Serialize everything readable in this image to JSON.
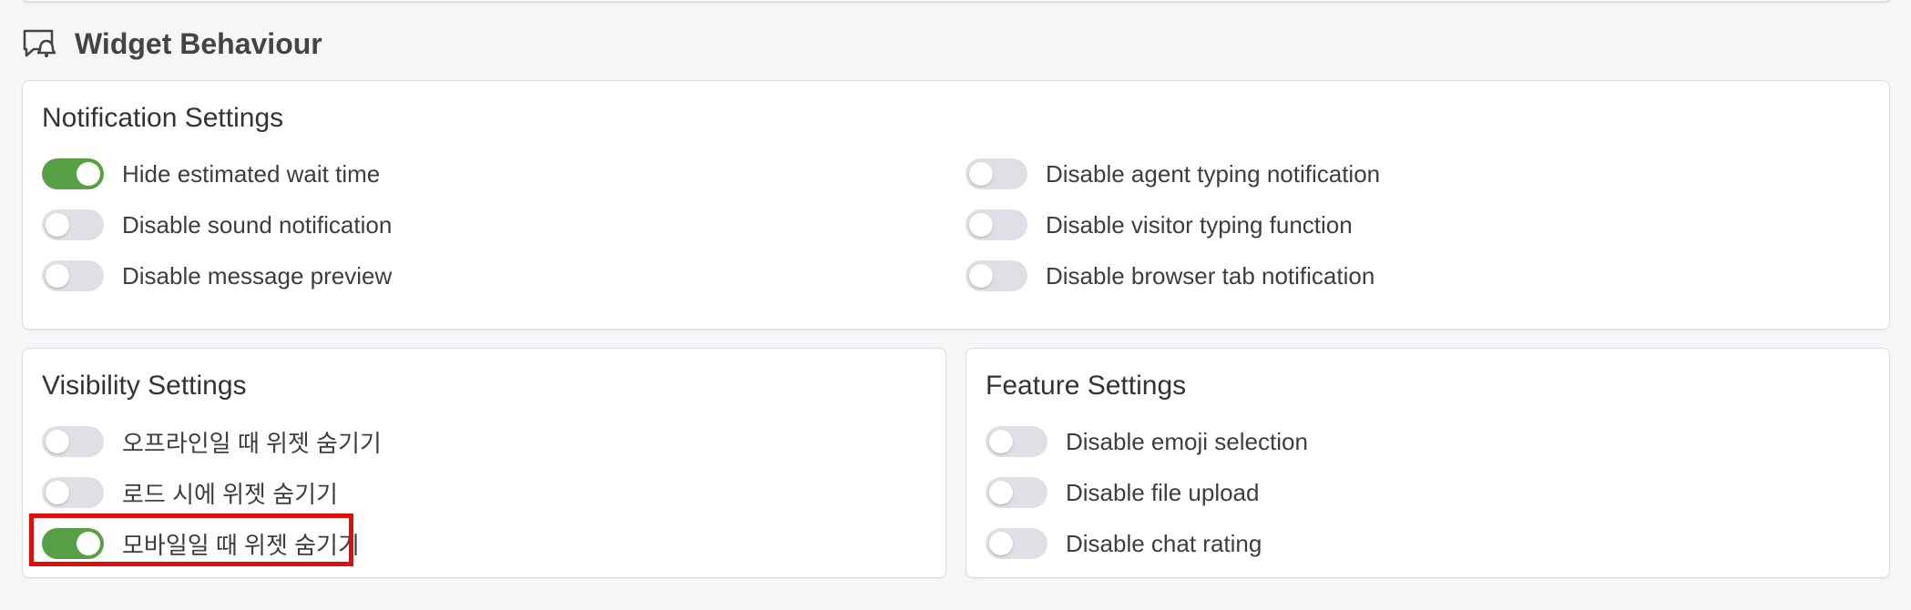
{
  "header": {
    "title": "Widget Behaviour",
    "icon": "chat-bell-icon"
  },
  "notification": {
    "title": "Notification Settings",
    "left": [
      {
        "label": "Hide estimated wait time",
        "on": true
      },
      {
        "label": "Disable sound notification",
        "on": false
      },
      {
        "label": "Disable message preview",
        "on": false
      }
    ],
    "right": [
      {
        "label": "Disable agent typing notification",
        "on": false
      },
      {
        "label": "Disable visitor typing function",
        "on": false
      },
      {
        "label": "Disable browser tab notification",
        "on": false
      }
    ]
  },
  "visibility": {
    "title": "Visibility Settings",
    "items": [
      {
        "label": "오프라인일 때 위젯 숨기기",
        "on": false
      },
      {
        "label": "로드 시에 위젯 숨기기",
        "on": false
      },
      {
        "label": "모바일일 때 위젯 숨기기",
        "on": true
      }
    ]
  },
  "feature": {
    "title": "Feature Settings",
    "items": [
      {
        "label": "Disable emoji selection",
        "on": false
      },
      {
        "label": "Disable file upload",
        "on": false
      },
      {
        "label": "Disable chat rating",
        "on": false
      }
    ]
  },
  "colors": {
    "toggle_on": "#58a045",
    "toggle_off": "#dfdfe6",
    "highlight": "#e10c0c"
  }
}
